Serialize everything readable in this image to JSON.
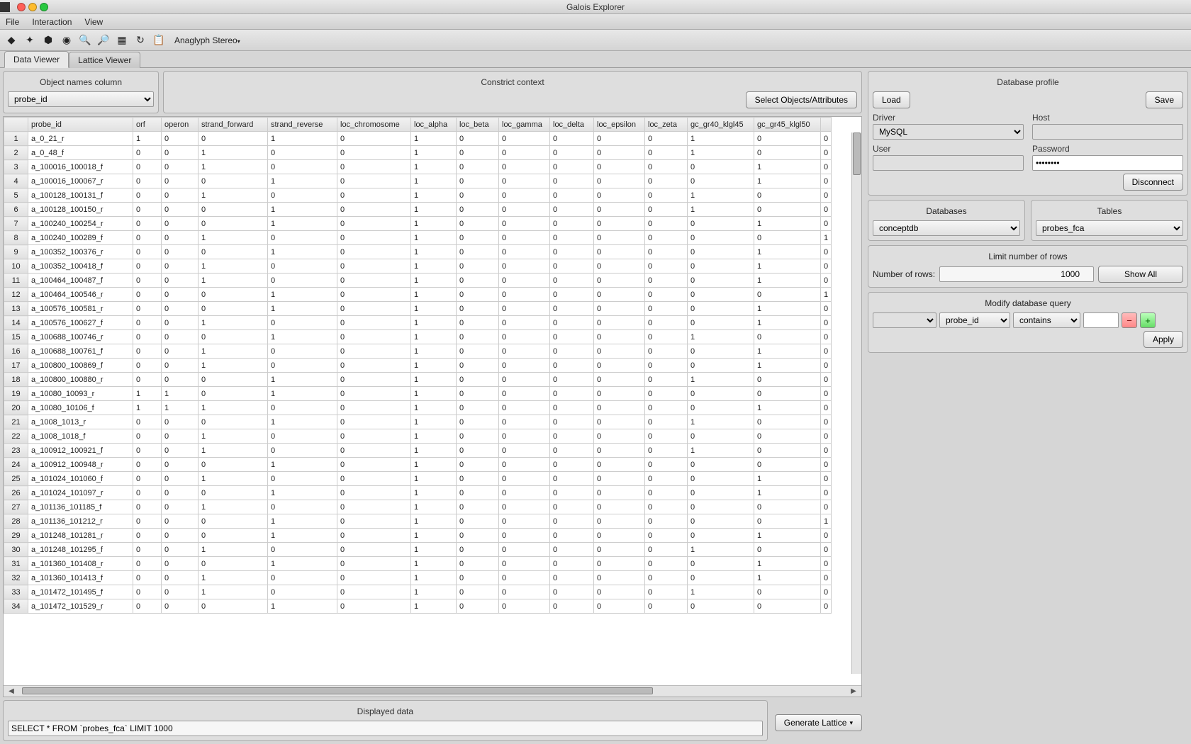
{
  "window": {
    "title": "Galois Explorer"
  },
  "menu": {
    "file": "File",
    "interaction": "Interaction",
    "view": "View"
  },
  "toolbar": {
    "stereo": "Anaglyph Stereo"
  },
  "tabs": {
    "data": "Data Viewer",
    "lattice": "Lattice Viewer"
  },
  "obj_col": {
    "title": "Object names column",
    "value": "probe_id"
  },
  "constrict": {
    "title": "Constrict context",
    "select_btn": "Select Objects/Attributes"
  },
  "columns": [
    "probe_id",
    "orf",
    "operon",
    "strand_forward",
    "strand_reverse",
    "loc_chromosome",
    "loc_alpha",
    "loc_beta",
    "loc_gamma",
    "loc_delta",
    "loc_epsilon",
    "loc_zeta",
    "gc_gr40_klgl45",
    "gc_gr45_klgl50"
  ],
  "rows": [
    [
      "a_0_21_r",
      "1",
      "0",
      "0",
      "1",
      "0",
      "1",
      "0",
      "0",
      "0",
      "0",
      "0",
      "1",
      "0",
      "0"
    ],
    [
      "a_0_48_f",
      "0",
      "0",
      "1",
      "0",
      "0",
      "1",
      "0",
      "0",
      "0",
      "0",
      "0",
      "1",
      "0",
      "0"
    ],
    [
      "a_100016_100018_f",
      "0",
      "0",
      "1",
      "0",
      "0",
      "1",
      "0",
      "0",
      "0",
      "0",
      "0",
      "0",
      "1",
      "0"
    ],
    [
      "a_100016_100067_r",
      "0",
      "0",
      "0",
      "1",
      "0",
      "1",
      "0",
      "0",
      "0",
      "0",
      "0",
      "0",
      "1",
      "0"
    ],
    [
      "a_100128_100131_f",
      "0",
      "0",
      "1",
      "0",
      "0",
      "1",
      "0",
      "0",
      "0",
      "0",
      "0",
      "1",
      "0",
      "0"
    ],
    [
      "a_100128_100150_r",
      "0",
      "0",
      "0",
      "1",
      "0",
      "1",
      "0",
      "0",
      "0",
      "0",
      "0",
      "1",
      "0",
      "0"
    ],
    [
      "a_100240_100254_r",
      "0",
      "0",
      "0",
      "1",
      "0",
      "1",
      "0",
      "0",
      "0",
      "0",
      "0",
      "0",
      "1",
      "0"
    ],
    [
      "a_100240_100289_f",
      "0",
      "0",
      "1",
      "0",
      "0",
      "1",
      "0",
      "0",
      "0",
      "0",
      "0",
      "0",
      "0",
      "1"
    ],
    [
      "a_100352_100376_r",
      "0",
      "0",
      "0",
      "1",
      "0",
      "1",
      "0",
      "0",
      "0",
      "0",
      "0",
      "0",
      "1",
      "0"
    ],
    [
      "a_100352_100418_f",
      "0",
      "0",
      "1",
      "0",
      "0",
      "1",
      "0",
      "0",
      "0",
      "0",
      "0",
      "0",
      "1",
      "0"
    ],
    [
      "a_100464_100487_f",
      "0",
      "0",
      "1",
      "0",
      "0",
      "1",
      "0",
      "0",
      "0",
      "0",
      "0",
      "0",
      "1",
      "0"
    ],
    [
      "a_100464_100546_r",
      "0",
      "0",
      "0",
      "1",
      "0",
      "1",
      "0",
      "0",
      "0",
      "0",
      "0",
      "0",
      "0",
      "1"
    ],
    [
      "a_100576_100581_r",
      "0",
      "0",
      "0",
      "1",
      "0",
      "1",
      "0",
      "0",
      "0",
      "0",
      "0",
      "0",
      "1",
      "0"
    ],
    [
      "a_100576_100627_f",
      "0",
      "0",
      "1",
      "0",
      "0",
      "1",
      "0",
      "0",
      "0",
      "0",
      "0",
      "0",
      "1",
      "0"
    ],
    [
      "a_100688_100746_r",
      "0",
      "0",
      "0",
      "1",
      "0",
      "1",
      "0",
      "0",
      "0",
      "0",
      "0",
      "1",
      "0",
      "0"
    ],
    [
      "a_100688_100761_f",
      "0",
      "0",
      "1",
      "0",
      "0",
      "1",
      "0",
      "0",
      "0",
      "0",
      "0",
      "0",
      "1",
      "0"
    ],
    [
      "a_100800_100869_f",
      "0",
      "0",
      "1",
      "0",
      "0",
      "1",
      "0",
      "0",
      "0",
      "0",
      "0",
      "0",
      "1",
      "0"
    ],
    [
      "a_100800_100880_r",
      "0",
      "0",
      "0",
      "1",
      "0",
      "1",
      "0",
      "0",
      "0",
      "0",
      "0",
      "1",
      "0",
      "0"
    ],
    [
      "a_10080_10093_r",
      "1",
      "1",
      "0",
      "1",
      "0",
      "1",
      "0",
      "0",
      "0",
      "0",
      "0",
      "0",
      "0",
      "0"
    ],
    [
      "a_10080_10106_f",
      "1",
      "1",
      "1",
      "0",
      "0",
      "1",
      "0",
      "0",
      "0",
      "0",
      "0",
      "0",
      "1",
      "0"
    ],
    [
      "a_1008_1013_r",
      "0",
      "0",
      "0",
      "1",
      "0",
      "1",
      "0",
      "0",
      "0",
      "0",
      "0",
      "1",
      "0",
      "0"
    ],
    [
      "a_1008_1018_f",
      "0",
      "0",
      "1",
      "0",
      "0",
      "1",
      "0",
      "0",
      "0",
      "0",
      "0",
      "0",
      "0",
      "0"
    ],
    [
      "a_100912_100921_f",
      "0",
      "0",
      "1",
      "0",
      "0",
      "1",
      "0",
      "0",
      "0",
      "0",
      "0",
      "1",
      "0",
      "0"
    ],
    [
      "a_100912_100948_r",
      "0",
      "0",
      "0",
      "1",
      "0",
      "1",
      "0",
      "0",
      "0",
      "0",
      "0",
      "0",
      "0",
      "0"
    ],
    [
      "a_101024_101060_f",
      "0",
      "0",
      "1",
      "0",
      "0",
      "1",
      "0",
      "0",
      "0",
      "0",
      "0",
      "0",
      "1",
      "0"
    ],
    [
      "a_101024_101097_r",
      "0",
      "0",
      "0",
      "1",
      "0",
      "1",
      "0",
      "0",
      "0",
      "0",
      "0",
      "0",
      "1",
      "0"
    ],
    [
      "a_101136_101185_f",
      "0",
      "0",
      "1",
      "0",
      "0",
      "1",
      "0",
      "0",
      "0",
      "0",
      "0",
      "0",
      "0",
      "0"
    ],
    [
      "a_101136_101212_r",
      "0",
      "0",
      "0",
      "1",
      "0",
      "1",
      "0",
      "0",
      "0",
      "0",
      "0",
      "0",
      "0",
      "1"
    ],
    [
      "a_101248_101281_r",
      "0",
      "0",
      "0",
      "1",
      "0",
      "1",
      "0",
      "0",
      "0",
      "0",
      "0",
      "0",
      "1",
      "0"
    ],
    [
      "a_101248_101295_f",
      "0",
      "0",
      "1",
      "0",
      "0",
      "1",
      "0",
      "0",
      "0",
      "0",
      "0",
      "1",
      "0",
      "0"
    ],
    [
      "a_101360_101408_r",
      "0",
      "0",
      "0",
      "1",
      "0",
      "1",
      "0",
      "0",
      "0",
      "0",
      "0",
      "0",
      "1",
      "0"
    ],
    [
      "a_101360_101413_f",
      "0",
      "0",
      "1",
      "0",
      "0",
      "1",
      "0",
      "0",
      "0",
      "0",
      "0",
      "0",
      "1",
      "0"
    ],
    [
      "a_101472_101495_f",
      "0",
      "0",
      "1",
      "0",
      "0",
      "1",
      "0",
      "0",
      "0",
      "0",
      "0",
      "1",
      "0",
      "0"
    ],
    [
      "a_101472_101529_r",
      "0",
      "0",
      "0",
      "1",
      "0",
      "1",
      "0",
      "0",
      "0",
      "0",
      "0",
      "0",
      "0",
      "0"
    ]
  ],
  "displayed": {
    "title": "Displayed data",
    "query": "SELECT * FROM `probes_fca` LIMIT 1000"
  },
  "gen_lattice": "Generate Lattice",
  "db": {
    "title": "Database profile",
    "load": "Load",
    "save": "Save",
    "driver_label": "Driver",
    "driver": "MySQL",
    "host_label": "Host",
    "host": "",
    "user_label": "User",
    "user": "",
    "password_label": "Password",
    "password": "••••••••",
    "disconnect": "Disconnect",
    "databases_label": "Databases",
    "database": "conceptdb",
    "tables_label": "Tables",
    "table": "probes_fca",
    "limit_title": "Limit number of rows",
    "nrows_label": "Number of rows:",
    "nrows": "1000",
    "show_all": "Show All",
    "modify_title": "Modify database query",
    "query_col": "probe_id",
    "query_op": "contains",
    "query_val": "",
    "apply": "Apply"
  }
}
